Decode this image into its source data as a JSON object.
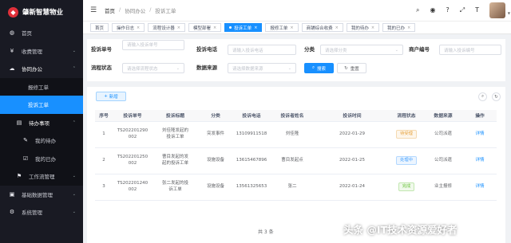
{
  "app": {
    "logo_glyph": "◆",
    "title": "肇新智慧物业"
  },
  "sidebar": {
    "items": [
      {
        "label": "首页",
        "icon": "dashboard-icon",
        "glyph": "◍"
      },
      {
        "label": "收费管理",
        "icon": "yen-icon",
        "glyph": "¥",
        "arrow": "⌄"
      },
      {
        "label": "协同办公",
        "icon": "cloud-icon",
        "glyph": "☁",
        "arrow": "⌃"
      },
      {
        "label": "报修工单"
      },
      {
        "label": "投诉工单"
      },
      {
        "label": "待办事项",
        "icon": "list-icon",
        "glyph": "▤",
        "arrow": "⌃"
      },
      {
        "label": "我的待办",
        "icon": "edit-icon",
        "glyph": "✎"
      },
      {
        "label": "我的已办",
        "icon": "check-square-icon",
        "glyph": "☑"
      },
      {
        "label": "工作流管理",
        "icon": "workflow-icon",
        "glyph": "⚑",
        "arrow": "⌄"
      },
      {
        "label": "基础数据管理",
        "icon": "database-icon",
        "glyph": "▣",
        "arrow": "⌄"
      },
      {
        "label": "系统管理",
        "icon": "gear-icon",
        "glyph": "⚙",
        "arrow": "⌄"
      }
    ]
  },
  "topbar": {
    "menu_glyph": "☰",
    "breadcrumb": [
      "首页",
      "/",
      "协同办公",
      "/",
      "投诉工单"
    ],
    "icons": [
      {
        "name": "search-icon",
        "glyph": "⌕"
      },
      {
        "name": "github-icon",
        "glyph": "◉"
      },
      {
        "name": "help-icon",
        "glyph": "?"
      },
      {
        "name": "fullscreen-icon",
        "glyph": "⤢"
      },
      {
        "name": "font-size-icon",
        "glyph": "T"
      }
    ],
    "avatar_caret": "▼"
  },
  "tags": [
    {
      "label": "首页"
    },
    {
      "label": "操作日志",
      "close": "×"
    },
    {
      "label": "流程设计器",
      "close": "×"
    },
    {
      "label": "模型部署",
      "close": "×"
    },
    {
      "label": "投诉工单",
      "close": "×",
      "active": true
    },
    {
      "label": "报修工单",
      "close": "×"
    },
    {
      "label": "商铺综合收费",
      "close": "×"
    },
    {
      "label": "我的待办",
      "close": "×"
    },
    {
      "label": "我的已办",
      "close": "×"
    }
  ],
  "search": {
    "complaint_no": {
      "label": "投诉单号",
      "placeholder": "请输入投诉单号"
    },
    "phone": {
      "label": "投诉电话",
      "placeholder": "请输入投诉电话"
    },
    "category": {
      "label": "分类",
      "placeholder": "请选择分类"
    },
    "shop_no": {
      "label": "商户编号",
      "placeholder": "请输入投诉编号"
    },
    "flow_status": {
      "label": "流程状态",
      "placeholder": "请选择流程状态"
    },
    "data_source": {
      "label": "数据来源",
      "placeholder": "请选择数据来源"
    },
    "caret": "⌄",
    "search_btn": "搜索",
    "search_glyph": "⌕",
    "reset_btn": "重置",
    "reset_glyph": "↻"
  },
  "toolbar": {
    "add_btn": "新增",
    "add_glyph": "+",
    "search_toggle_glyph": "⌕",
    "refresh_glyph": "↻"
  },
  "table": {
    "headers": [
      "序号",
      "投诉单号",
      "投诉标题",
      "分类",
      "投诉电话",
      "投诉者姓名",
      "投诉时间",
      "流程状态",
      "数据来源",
      "操作"
    ],
    "rows": [
      {
        "no": "1",
        "code": [
          "TS202201290",
          "002"
        ],
        "title": [
          "刘佳隆发起的",
          "投诉工单"
        ],
        "category": "突发事件",
        "phone": "13109911518",
        "name": "刘佳隆",
        "time": "2022-01-29",
        "status": "待受理",
        "status_type": "warn",
        "source": "公司派遣",
        "action": "详情"
      },
      {
        "no": "2",
        "code": [
          "TS202201250",
          "002"
        ],
        "title": [
          "曹目发起的发",
          "起的投诉工单"
        ],
        "category": "设施设备",
        "phone": "13615467896",
        "name": "曹目发起点",
        "time": "2022-01-25",
        "status": "处理中",
        "status_type": "info",
        "source": "公司派遣",
        "action": "详情"
      },
      {
        "no": "3",
        "code": [
          "TS202201240",
          "002"
        ],
        "title": [
          "张二发起的投",
          "诉工单"
        ],
        "category": "设施设备",
        "phone": "13561325653",
        "name": "张二",
        "time": "2022-01-24",
        "status": "完成",
        "status_type": "ok",
        "source": "业主报修",
        "action": "详情"
      }
    ]
  },
  "pagination": {
    "total": "共 3 条"
  },
  "watermark": "头条 @IT技术资源爱好者"
}
